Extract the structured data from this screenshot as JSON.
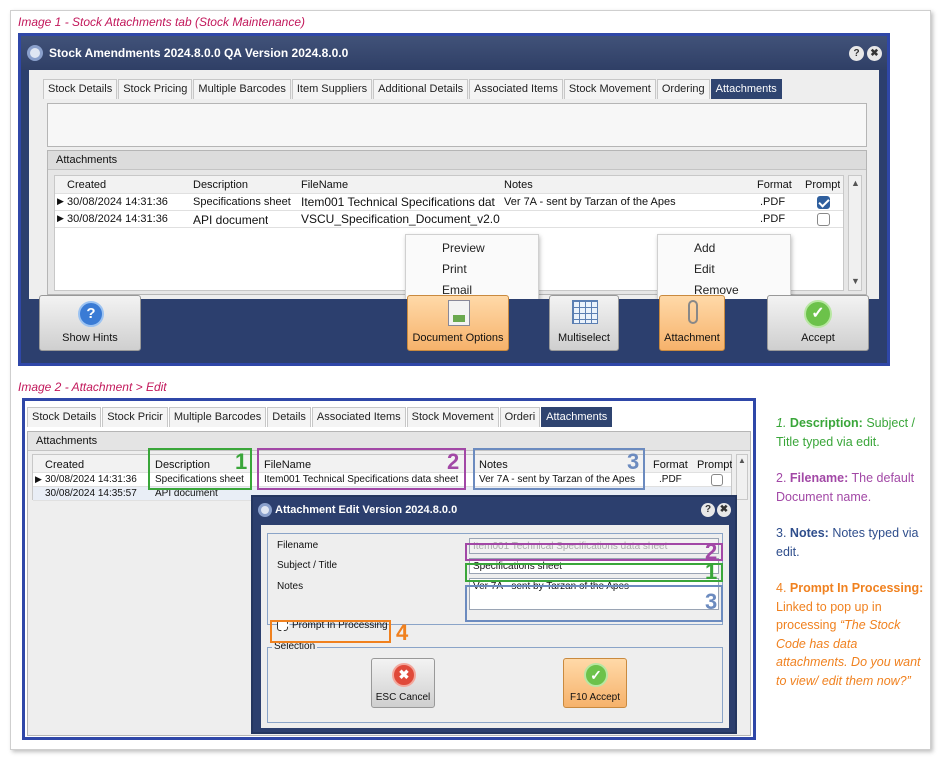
{
  "captions": {
    "image1": "Image 1 - Stock Attachments tab (Stock Maintenance)",
    "image2": "Image 2 - Attachment > Edit"
  },
  "window1": {
    "title": "Stock Amendments 2024.8.0.0 QA Version 2024.8.0.0",
    "help_icon": "?",
    "close_icon": "✖",
    "tabs": [
      "Stock Details",
      "Stock Pricing",
      "Multiple Barcodes",
      "Item Suppliers",
      "Additional Details",
      "Associated Items",
      "Stock Movement",
      "Ordering",
      "Attachments"
    ],
    "active_tab": "Attachments",
    "group_label": "Attachments",
    "columns": [
      "Created",
      "Description",
      "FileName",
      "Notes",
      "Format",
      "Prompt"
    ],
    "rows": [
      {
        "created": "30/08/2024 14:31:36",
        "description": "Specifications sheet",
        "filename": "Item001 Technical Specifications dat",
        "notes": "Ver 7A - sent by Tarzan of the Apes",
        "format": ".PDF",
        "prompt": true
      },
      {
        "created": "30/08/2024 14:31:36",
        "description": "API document",
        "filename": "VSCU_Specification_Document_v2.0",
        "notes": "",
        "format": ".PDF",
        "prompt": false
      }
    ],
    "context_menu_left": [
      "Preview",
      "Print",
      "Email"
    ],
    "context_menu_right": [
      "Add",
      "Edit",
      "Remove"
    ],
    "buttons": {
      "show_hints": "Show Hints",
      "document_options": "Document Options",
      "multiselect": "Multiselect",
      "attachment": "Attachment",
      "accept": "Accept"
    }
  },
  "window2": {
    "tabs": [
      "Stock Details",
      "Stock Pricir",
      "Multiple Barcodes",
      "Details",
      "Associated Items",
      "Stock Movement",
      "Orderi",
      "Attachments"
    ],
    "active_tab": "Attachments",
    "group_label": "Attachments",
    "columns": [
      "Created",
      "Description",
      "FileName",
      "Notes",
      "Format",
      "Prompt"
    ],
    "rows": [
      {
        "created": "30/08/2024 14:31:36",
        "description": "Specifications sheet",
        "filename": "Item001 Technical Specifications data sheet",
        "notes": "Ver 7A - sent by Tarzan of the Apes",
        "format": ".PDF",
        "prompt": false
      },
      {
        "created": "30/08/2024 14:35:57",
        "description": "API document",
        "filename": "",
        "notes": "",
        "format": "",
        "prompt": false
      }
    ],
    "dialog": {
      "title": "Attachment Edit Version 2024.8.0.0",
      "filename_label": "Filename",
      "subject_label": "Subject / Title",
      "notes_label": "Notes",
      "filename_value": "Item001 Technical Specifications data sheet",
      "subject_value": "Specifications sheet",
      "notes_value": "Ver 7A - sent by Tarzan of the Apes",
      "prompt_label": "Prompt In Processing",
      "prompt_checked": true,
      "selection_label": "Selection",
      "cancel_label": "ESC Cancel",
      "accept_label": "F10 Accept"
    },
    "markers": {
      "one": "1",
      "two": "2",
      "three": "3",
      "four": "4"
    }
  },
  "notes": [
    {
      "num": "1.",
      "title": "Description:",
      "text": "Subject / Title typed via edit.",
      "color": "#3aa63a",
      "title_color": "#3aa63a"
    },
    {
      "num": "2.",
      "title": "Filename:",
      "text": "The default Document name.",
      "color": "#a248a6",
      "title_color": "#a248a6"
    },
    {
      "num": "3.",
      "title": "Notes:",
      "text": "Notes typed via edit.",
      "color": "#2f4e8c",
      "title_color": "#2f4e8c"
    },
    {
      "num": "4.",
      "title": "Prompt In Processing:",
      "text": "Linked to pop up in processing",
      "quote": "“The Stock Code has data attachments. Do you want to view/ edit them now?”",
      "color": "#f0811f",
      "title_color": "#f0811f"
    }
  ],
  "colors": {
    "green": "#3aa63a",
    "purple": "#a248a6",
    "blue": "#6c8bbf",
    "orange": "#f0811f",
    "window_border": "#2f47a8",
    "title_bg": "#2c3f6e"
  }
}
